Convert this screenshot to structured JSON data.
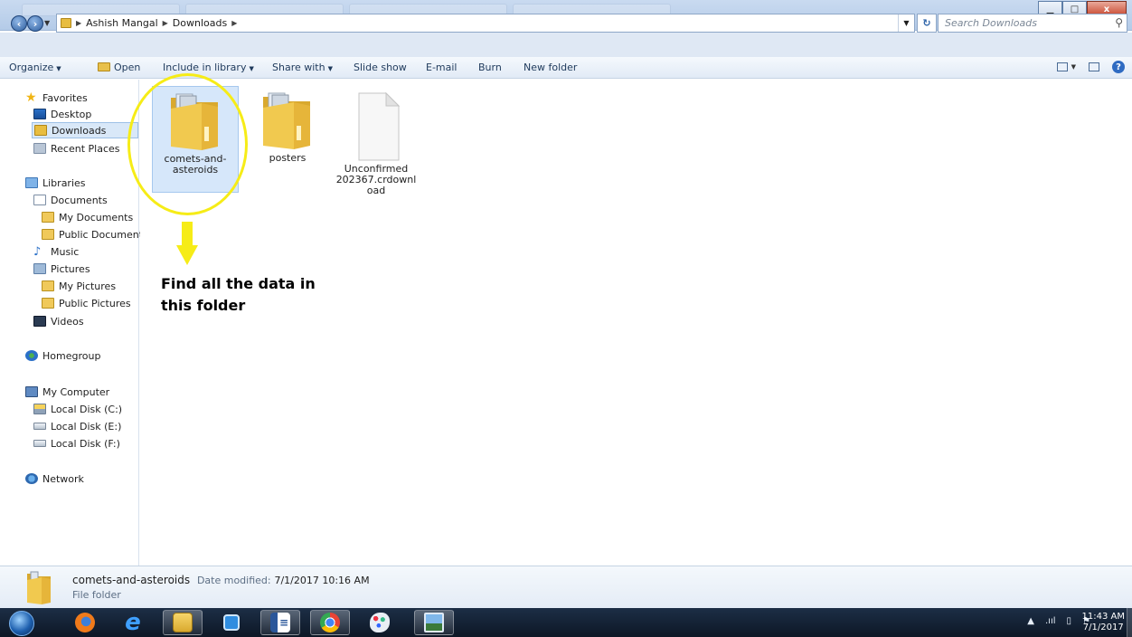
{
  "window": {
    "address_crumbs": [
      "Ashish Mangal",
      "Downloads"
    ],
    "search_placeholder": "Search Downloads",
    "min_label": "▁",
    "max_label": "□",
    "close_label": "x"
  },
  "toolbar": {
    "organize": "Organize",
    "open": "Open",
    "include_in_library": "Include in library",
    "share_with": "Share with",
    "slide_show": "Slide show",
    "email": "E-mail",
    "burn": "Burn",
    "new_folder": "New folder"
  },
  "nav": {
    "favorites": "Favorites",
    "desktop": "Desktop",
    "downloads": "Downloads",
    "recent_places": "Recent Places",
    "libraries": "Libraries",
    "documents": "Documents",
    "my_documents": "My Documents",
    "public_documents": "Public Documents",
    "music": "Music",
    "pictures": "Pictures",
    "my_pictures": "My Pictures",
    "public_pictures": "Public Pictures",
    "videos": "Videos",
    "homegroup": "Homegroup",
    "my_computer": "My Computer",
    "disk_c": "Local Disk (C:)",
    "disk_e": "Local Disk (E:)",
    "disk_f": "Local Disk (F:)",
    "network": "Network"
  },
  "files": [
    {
      "label": "comets-and-asteroids",
      "type": "folder",
      "selected": true
    },
    {
      "label": "posters",
      "type": "folder",
      "selected": false
    },
    {
      "label": "Unconfirmed 202367.crdownload",
      "type": "file",
      "selected": false
    }
  ],
  "annotation": {
    "line1": "Find all the data in",
    "line2": "this folder",
    "color": "#f6ec17"
  },
  "details": {
    "name": "comets-and-asteroids",
    "modified_label": "Date modified:",
    "modified_value": "7/1/2017 10:16 AM",
    "type": "File folder"
  },
  "taskbar": {
    "time": "11:43 AM",
    "date": "7/1/2017",
    "icons": [
      "firefox-icon",
      "internet-explorer-icon",
      "explorer-icon",
      "media-icon",
      "word-icon",
      "chrome-icon",
      "paint-icon",
      "photo-viewer-icon"
    ]
  }
}
